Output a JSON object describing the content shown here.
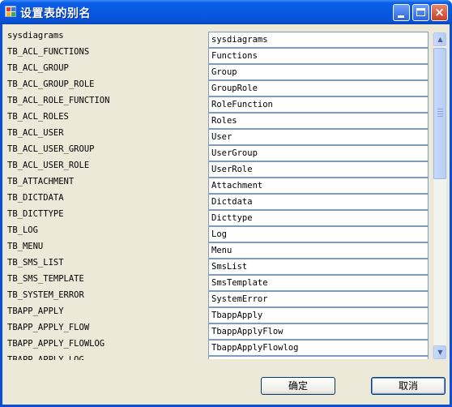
{
  "window": {
    "title": "设置表的别名",
    "minimize_glyph": "_",
    "close_glyph": "×",
    "icon": "app-icon"
  },
  "rows": [
    {
      "name": "sysdiagrams",
      "alias": "sysdiagrams"
    },
    {
      "name": "TB_ACL_FUNCTIONS",
      "alias": "Functions"
    },
    {
      "name": "TB_ACL_GROUP",
      "alias": "Group"
    },
    {
      "name": "TB_ACL_GROUP_ROLE",
      "alias": "GroupRole"
    },
    {
      "name": "TB_ACL_ROLE_FUNCTION",
      "alias": "RoleFunction"
    },
    {
      "name": "TB_ACL_ROLES",
      "alias": "Roles"
    },
    {
      "name": "TB_ACL_USER",
      "alias": "User"
    },
    {
      "name": "TB_ACL_USER_GROUP",
      "alias": "UserGroup"
    },
    {
      "name": "TB_ACL_USER_ROLE",
      "alias": "UserRole"
    },
    {
      "name": "TB_ATTACHMENT",
      "alias": "Attachment"
    },
    {
      "name": "TB_DICTDATA",
      "alias": "Dictdata"
    },
    {
      "name": "TB_DICTTYPE",
      "alias": "Dicttype"
    },
    {
      "name": "TB_LOG",
      "alias": "Log"
    },
    {
      "name": "TB_MENU",
      "alias": "Menu"
    },
    {
      "name": "TB_SMS_LIST",
      "alias": "SmsList"
    },
    {
      "name": "TB_SMS_TEMPLATE",
      "alias": "SmsTemplate"
    },
    {
      "name": "TB_SYSTEM_ERROR",
      "alias": "SystemError"
    },
    {
      "name": "TBAPP_APPLY",
      "alias": "TbappApply"
    },
    {
      "name": "TBAPP_APPLY_FLOW",
      "alias": "TbappApplyFlow"
    },
    {
      "name": "TBAPP_APPLY_FLOWLOG",
      "alias": "TbappApplyFlowlog"
    },
    {
      "name": "TBAPP_APPLY_LOG",
      "alias": ""
    }
  ],
  "buttons": {
    "ok": "确定",
    "cancel": "取消"
  },
  "scrollbar": {
    "position_fraction": 0.0,
    "visible_fraction": 0.45
  }
}
